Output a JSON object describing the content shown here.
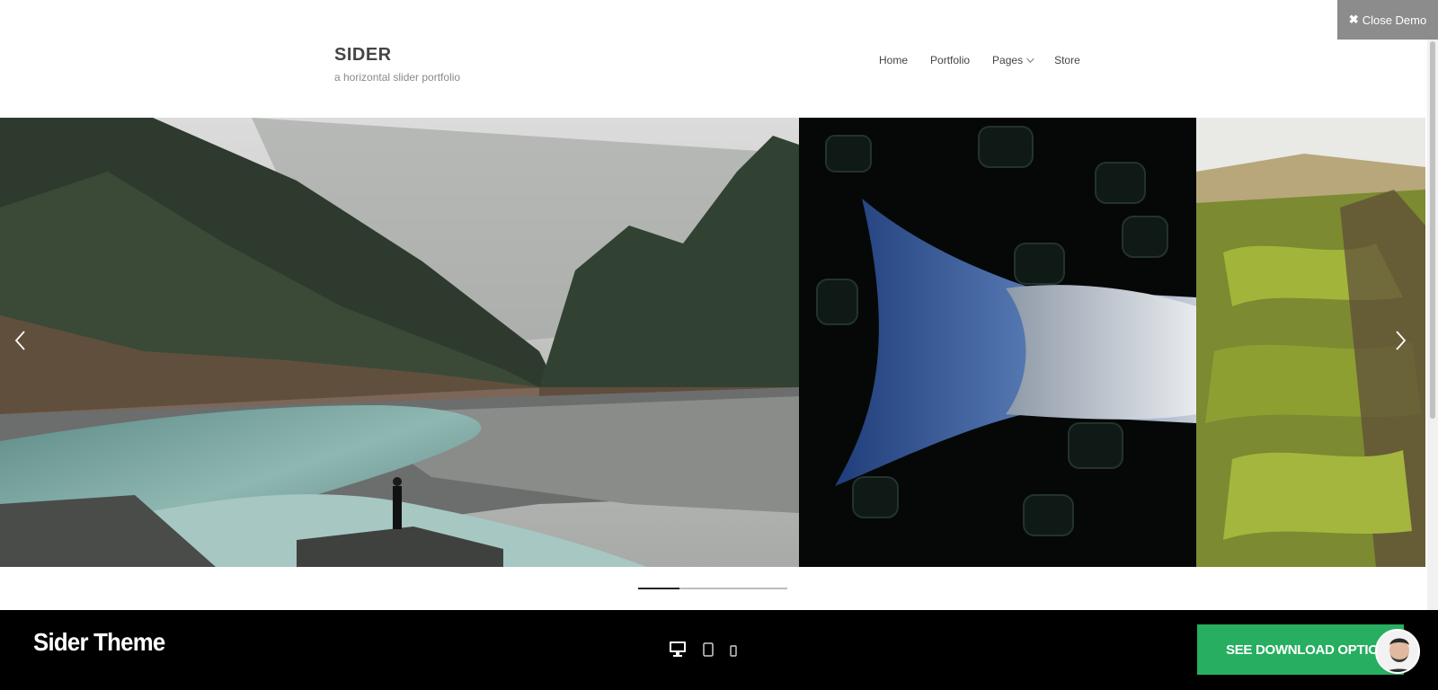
{
  "header": {
    "brand_title": "SIDER",
    "brand_tagline": "a horizontal slider portfolio",
    "nav": [
      {
        "label": "Home"
      },
      {
        "label": "Portfolio"
      },
      {
        "label": "Pages",
        "has_dropdown": true
      },
      {
        "label": "Store"
      }
    ]
  },
  "close_demo": {
    "label": "Close Demo",
    "icon": "close-icon"
  },
  "slider": {
    "slides": [
      {
        "subject": "misty forest river with person standing on rocks"
      },
      {
        "subject": "fish tail on black ice"
      },
      {
        "subject": "mossy cliff landscape"
      }
    ],
    "prev_icon": "chevron-left-icon",
    "next_icon": "chevron-right-icon",
    "progress_fraction": 0.28
  },
  "bottom_bar": {
    "theme_name": "Sider Theme",
    "devices": [
      "desktop-icon",
      "tablet-icon",
      "mobile-icon"
    ],
    "download_label": "SEE DOWNLOAD OPTIONS",
    "accent": "#27ae60"
  }
}
